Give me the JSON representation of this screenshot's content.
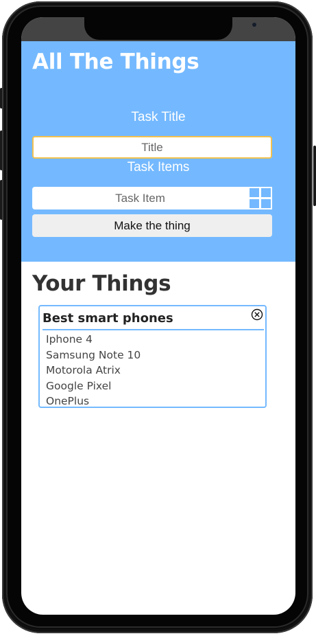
{
  "app": {
    "title": "All The Things"
  },
  "form": {
    "title_label": "Task Title",
    "title_placeholder": "Title",
    "items_label": "Task Items",
    "item_placeholder": "Task Item",
    "add_icon": "plus-grid-icon",
    "make_button": "Make the thing"
  },
  "list_section": {
    "title": "Your Things",
    "cards": [
      {
        "title": "Best smart phones",
        "close_icon": "circle-x-icon",
        "items": [
          "Iphone 4",
          "Samsung Note 10",
          "Motorola Atrix",
          "Google Pixel",
          "OnePlus"
        ]
      }
    ]
  },
  "colors": {
    "accent": "#74b9ff",
    "focus_border": "#f2c14e",
    "heading_text": "#333333"
  }
}
